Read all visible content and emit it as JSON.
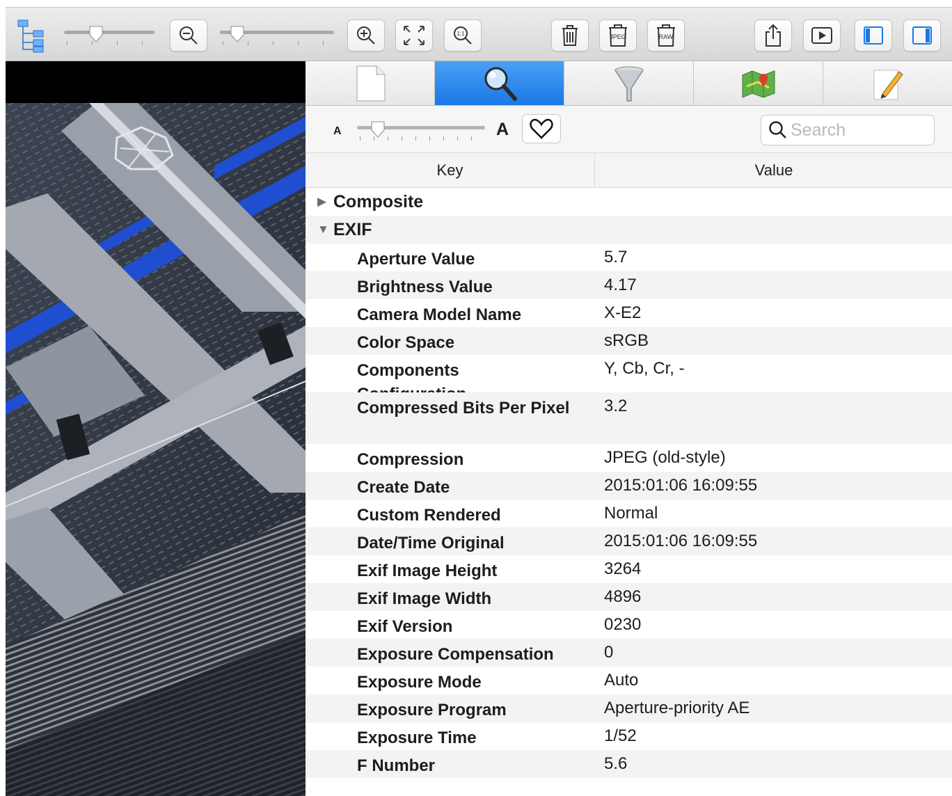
{
  "toolbar": {
    "icons": [
      "hierarchy-icon",
      "zoom-out-icon",
      "zoom-in-icon",
      "fit-to-window-icon",
      "actual-size-icon",
      "trash-icon",
      "jpeg-icon",
      "raw-icon",
      "share-icon",
      "slideshow-icon",
      "left-sidebar-icon",
      "right-sidebar-icon"
    ],
    "actual_size_label": "1:1",
    "jpeg_label": "JPEG",
    "raw_label": "RAW"
  },
  "tabs": [
    {
      "id": "file",
      "icon": "document-icon"
    },
    {
      "id": "metadata",
      "icon": "magnifier-icon",
      "active": true
    },
    {
      "id": "filter",
      "icon": "funnel-icon"
    },
    {
      "id": "map",
      "icon": "map-icon"
    },
    {
      "id": "edit",
      "icon": "pencil-icon"
    }
  ],
  "filter": {
    "small_a": "A",
    "big_a": "A",
    "search_placeholder": "Search"
  },
  "table": {
    "key_header": "Key",
    "value_header": "Value",
    "groups": {
      "composite": "Composite",
      "exif": "EXIF"
    },
    "exif_rows": [
      {
        "key": "Aperture Value",
        "value": "5.7"
      },
      {
        "key": "Brightness Value",
        "value": "4.17"
      },
      {
        "key": "Camera Model Name",
        "value": "X-E2"
      },
      {
        "key": "Color Space",
        "value": "sRGB"
      },
      {
        "key": "Components Configuration",
        "value": "Y, Cb, Cr, -"
      },
      {
        "key": "Compressed Bits Per Pixel",
        "value": "3.2"
      },
      {
        "key": "Compression",
        "value": "JPEG (old-style)"
      },
      {
        "key": "Create Date",
        "value": "2015:01:06 16:09:55"
      },
      {
        "key": "Custom Rendered",
        "value": "Normal"
      },
      {
        "key": "Date/Time Original",
        "value": "2015:01:06 16:09:55"
      },
      {
        "key": "Exif Image Height",
        "value": "3264"
      },
      {
        "key": "Exif Image Width",
        "value": "4896"
      },
      {
        "key": "Exif Version",
        "value": "0230"
      },
      {
        "key": "Exposure Compensation",
        "value": "0"
      },
      {
        "key": "Exposure Mode",
        "value": "Auto"
      },
      {
        "key": "Exposure Program",
        "value": "Aperture-priority AE"
      },
      {
        "key": "Exposure Time",
        "value": "1/52"
      },
      {
        "key": "F Number",
        "value": "5.6"
      }
    ]
  },
  "colors": {
    "accent": "#1a78e6",
    "photo_blue": "#1f4fd0"
  }
}
